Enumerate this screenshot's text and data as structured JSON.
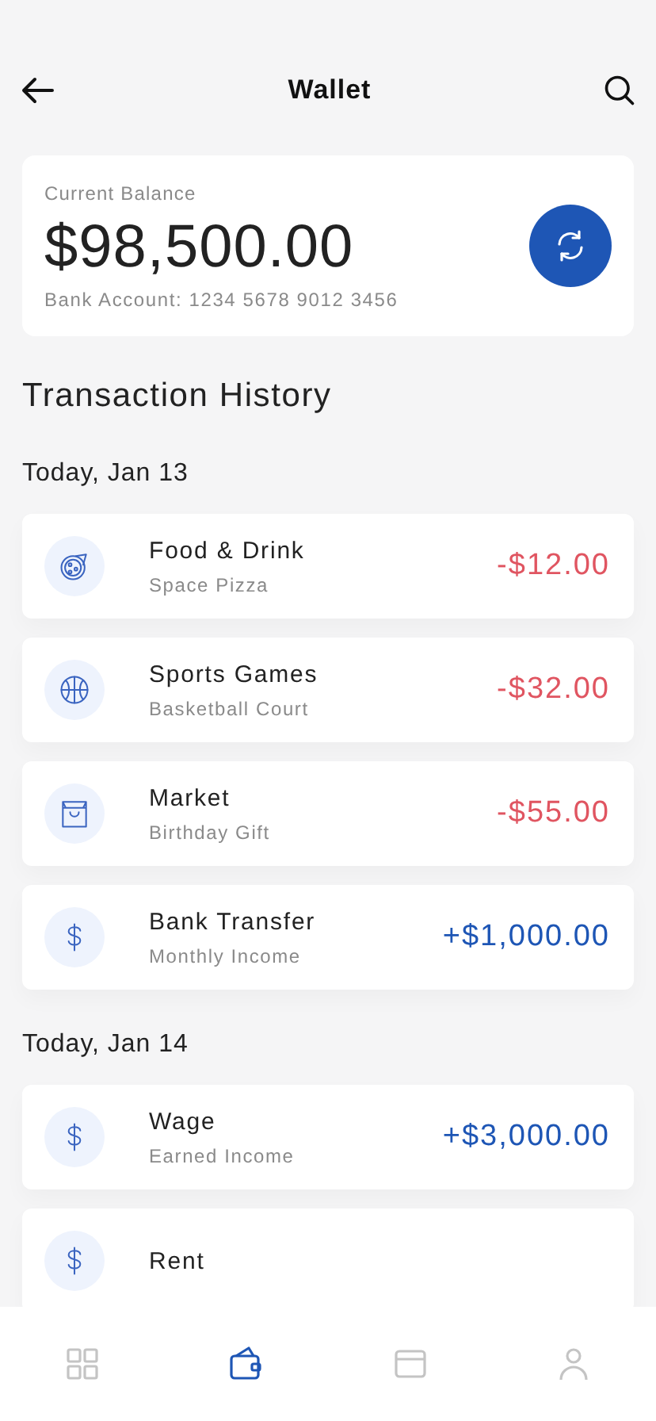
{
  "header": {
    "title": "Wallet"
  },
  "balance": {
    "label": "Current Balance",
    "amount": "$98,500.00",
    "account": "Bank Account: 1234 5678 9012 3456"
  },
  "history_title": "Transaction History",
  "groups": [
    {
      "date": "Today, Jan 13",
      "transactions": [
        {
          "kind": "pizza",
          "title": "Food & Drink",
          "subtitle": "Space Pizza",
          "amount": "-$12.00",
          "color": "#e05561"
        },
        {
          "kind": "basketball",
          "title": "Sports Games",
          "subtitle": "Basketball Court",
          "amount": "-$32.00",
          "color": "#e05561"
        },
        {
          "kind": "bag",
          "title": "Market",
          "subtitle": "Birthday Gift",
          "amount": "-$55.00",
          "color": "#e05561"
        },
        {
          "kind": "dollar",
          "title": "Bank Transfer",
          "subtitle": "Monthly Income",
          "amount": "+$1,000.00",
          "color": "#1e56b5"
        }
      ]
    },
    {
      "date": "Today, Jan 14",
      "transactions": [
        {
          "kind": "dollar",
          "title": "Wage",
          "subtitle": "Earned Income",
          "amount": "+$3,000.00",
          "color": "#1e56b5"
        },
        {
          "kind": "dollar",
          "title": "Rent"
        }
      ]
    }
  ],
  "nav": [
    {
      "kind": "grid",
      "selected": false
    },
    {
      "kind": "wallet",
      "selected": true
    },
    {
      "kind": "card",
      "selected": false
    },
    {
      "kind": "person",
      "selected": false
    }
  ]
}
